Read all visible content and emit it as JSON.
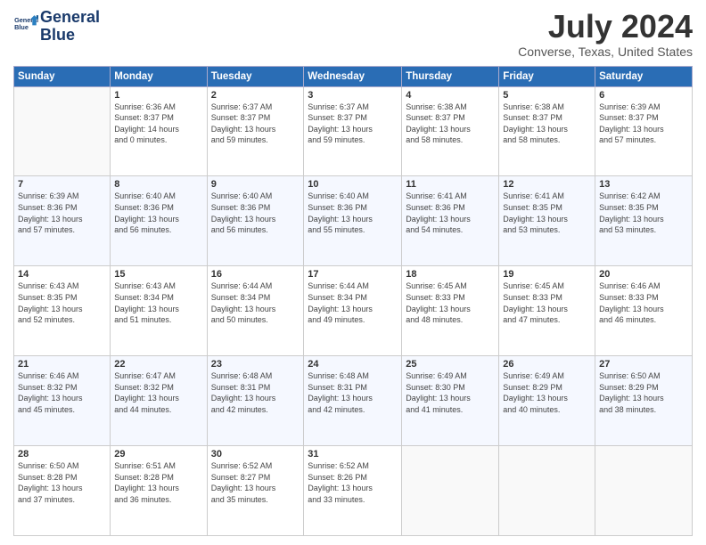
{
  "header": {
    "logo_line1": "General",
    "logo_line2": "Blue",
    "month_year": "July 2024",
    "location": "Converse, Texas, United States"
  },
  "weekdays": [
    "Sunday",
    "Monday",
    "Tuesday",
    "Wednesday",
    "Thursday",
    "Friday",
    "Saturday"
  ],
  "weeks": [
    [
      {
        "day": "",
        "info": ""
      },
      {
        "day": "1",
        "info": "Sunrise: 6:36 AM\nSunset: 8:37 PM\nDaylight: 14 hours\nand 0 minutes."
      },
      {
        "day": "2",
        "info": "Sunrise: 6:37 AM\nSunset: 8:37 PM\nDaylight: 13 hours\nand 59 minutes."
      },
      {
        "day": "3",
        "info": "Sunrise: 6:37 AM\nSunset: 8:37 PM\nDaylight: 13 hours\nand 59 minutes."
      },
      {
        "day": "4",
        "info": "Sunrise: 6:38 AM\nSunset: 8:37 PM\nDaylight: 13 hours\nand 58 minutes."
      },
      {
        "day": "5",
        "info": "Sunrise: 6:38 AM\nSunset: 8:37 PM\nDaylight: 13 hours\nand 58 minutes."
      },
      {
        "day": "6",
        "info": "Sunrise: 6:39 AM\nSunset: 8:37 PM\nDaylight: 13 hours\nand 57 minutes."
      }
    ],
    [
      {
        "day": "7",
        "info": "Sunrise: 6:39 AM\nSunset: 8:36 PM\nDaylight: 13 hours\nand 57 minutes."
      },
      {
        "day": "8",
        "info": "Sunrise: 6:40 AM\nSunset: 8:36 PM\nDaylight: 13 hours\nand 56 minutes."
      },
      {
        "day": "9",
        "info": "Sunrise: 6:40 AM\nSunset: 8:36 PM\nDaylight: 13 hours\nand 56 minutes."
      },
      {
        "day": "10",
        "info": "Sunrise: 6:40 AM\nSunset: 8:36 PM\nDaylight: 13 hours\nand 55 minutes."
      },
      {
        "day": "11",
        "info": "Sunrise: 6:41 AM\nSunset: 8:36 PM\nDaylight: 13 hours\nand 54 minutes."
      },
      {
        "day": "12",
        "info": "Sunrise: 6:41 AM\nSunset: 8:35 PM\nDaylight: 13 hours\nand 53 minutes."
      },
      {
        "day": "13",
        "info": "Sunrise: 6:42 AM\nSunset: 8:35 PM\nDaylight: 13 hours\nand 53 minutes."
      }
    ],
    [
      {
        "day": "14",
        "info": "Sunrise: 6:43 AM\nSunset: 8:35 PM\nDaylight: 13 hours\nand 52 minutes."
      },
      {
        "day": "15",
        "info": "Sunrise: 6:43 AM\nSunset: 8:34 PM\nDaylight: 13 hours\nand 51 minutes."
      },
      {
        "day": "16",
        "info": "Sunrise: 6:44 AM\nSunset: 8:34 PM\nDaylight: 13 hours\nand 50 minutes."
      },
      {
        "day": "17",
        "info": "Sunrise: 6:44 AM\nSunset: 8:34 PM\nDaylight: 13 hours\nand 49 minutes."
      },
      {
        "day": "18",
        "info": "Sunrise: 6:45 AM\nSunset: 8:33 PM\nDaylight: 13 hours\nand 48 minutes."
      },
      {
        "day": "19",
        "info": "Sunrise: 6:45 AM\nSunset: 8:33 PM\nDaylight: 13 hours\nand 47 minutes."
      },
      {
        "day": "20",
        "info": "Sunrise: 6:46 AM\nSunset: 8:33 PM\nDaylight: 13 hours\nand 46 minutes."
      }
    ],
    [
      {
        "day": "21",
        "info": "Sunrise: 6:46 AM\nSunset: 8:32 PM\nDaylight: 13 hours\nand 45 minutes."
      },
      {
        "day": "22",
        "info": "Sunrise: 6:47 AM\nSunset: 8:32 PM\nDaylight: 13 hours\nand 44 minutes."
      },
      {
        "day": "23",
        "info": "Sunrise: 6:48 AM\nSunset: 8:31 PM\nDaylight: 13 hours\nand 42 minutes."
      },
      {
        "day": "24",
        "info": "Sunrise: 6:48 AM\nSunset: 8:31 PM\nDaylight: 13 hours\nand 42 minutes."
      },
      {
        "day": "25",
        "info": "Sunrise: 6:49 AM\nSunset: 8:30 PM\nDaylight: 13 hours\nand 41 minutes."
      },
      {
        "day": "26",
        "info": "Sunrise: 6:49 AM\nSunset: 8:29 PM\nDaylight: 13 hours\nand 40 minutes."
      },
      {
        "day": "27",
        "info": "Sunrise: 6:50 AM\nSunset: 8:29 PM\nDaylight: 13 hours\nand 38 minutes."
      }
    ],
    [
      {
        "day": "28",
        "info": "Sunrise: 6:50 AM\nSunset: 8:28 PM\nDaylight: 13 hours\nand 37 minutes."
      },
      {
        "day": "29",
        "info": "Sunrise: 6:51 AM\nSunset: 8:28 PM\nDaylight: 13 hours\nand 36 minutes."
      },
      {
        "day": "30",
        "info": "Sunrise: 6:52 AM\nSunset: 8:27 PM\nDaylight: 13 hours\nand 35 minutes."
      },
      {
        "day": "31",
        "info": "Sunrise: 6:52 AM\nSunset: 8:26 PM\nDaylight: 13 hours\nand 33 minutes."
      },
      {
        "day": "",
        "info": ""
      },
      {
        "day": "",
        "info": ""
      },
      {
        "day": "",
        "info": ""
      }
    ]
  ]
}
